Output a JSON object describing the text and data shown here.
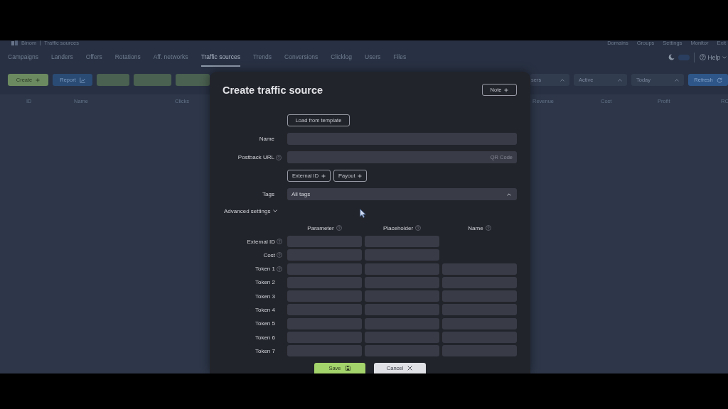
{
  "header": {
    "brand": "Binom",
    "breadcrumb": "Traffic sources",
    "links": [
      "Domains",
      "Groups",
      "Settings",
      "Monitor",
      "Exit"
    ]
  },
  "nav": {
    "tabs": [
      {
        "label": "Campaigns",
        "selected": false
      },
      {
        "label": "Landers",
        "selected": false
      },
      {
        "label": "Offers",
        "selected": false
      },
      {
        "label": "Rotations",
        "selected": false
      },
      {
        "label": "Aff. networks",
        "selected": false
      },
      {
        "label": "Traffic sources",
        "selected": true
      },
      {
        "label": "Trends",
        "selected": false
      },
      {
        "label": "Conversions",
        "selected": false
      },
      {
        "label": "Clicklog",
        "selected": false
      },
      {
        "label": "Users",
        "selected": false
      },
      {
        "label": "Files",
        "selected": false
      }
    ],
    "theme_toggle": {
      "on": true
    },
    "help": "Help"
  },
  "toolbar": {
    "buttons": [
      {
        "kind": "create",
        "label": "Create"
      },
      {
        "kind": "report",
        "label": "Report"
      },
      {
        "kind": "action"
      },
      {
        "kind": "action"
      },
      {
        "kind": "action"
      }
    ],
    "filters": [
      {
        "value": "sers"
      },
      {
        "value": "Active"
      },
      {
        "value": "Today"
      }
    ],
    "refresh": "Refresh"
  },
  "table": {
    "columns": [
      "ID",
      "Name",
      "Clicks",
      "Revenue",
      "Cost",
      "Profit",
      "RO"
    ]
  },
  "dialog": {
    "title": "Create traffic source",
    "note": "Note",
    "template": "Load from template",
    "fields": [
      {
        "label": "Name",
        "help": false,
        "kind": "text"
      },
      {
        "label": "Postback URL",
        "help": true,
        "kind": "url",
        "action": "QR Code"
      }
    ],
    "postback_tokens": [
      "External ID",
      "Payout"
    ],
    "tags": {
      "label": "Tags",
      "value": "All tags"
    },
    "advanced": {
      "label": "Advanced settings",
      "expanded": true
    },
    "columns": [
      {
        "label": "Parameter",
        "help": true
      },
      {
        "label": "Placeholder",
        "help": true
      },
      {
        "label": "Name",
        "help": true
      }
    ],
    "rows": [
      {
        "label": "External ID",
        "help": true,
        "kind": "pair"
      },
      {
        "label": "Cost",
        "help": true,
        "kind": "pair"
      },
      {
        "label": "Token 1",
        "help": true,
        "kind": "token"
      },
      {
        "label": "Token 2",
        "help": false,
        "kind": "token"
      },
      {
        "label": "Token 3",
        "help": false,
        "kind": "token"
      },
      {
        "label": "Token 4",
        "help": false,
        "kind": "token"
      },
      {
        "label": "Token 5",
        "help": false,
        "kind": "token"
      },
      {
        "label": "Token 6",
        "help": false,
        "kind": "token"
      },
      {
        "label": "Token 7",
        "help": false,
        "kind": "token"
      }
    ],
    "buttons": [
      {
        "kind": "save",
        "label": "Save"
      },
      {
        "kind": "cancel",
        "label": "Cancel"
      }
    ]
  }
}
